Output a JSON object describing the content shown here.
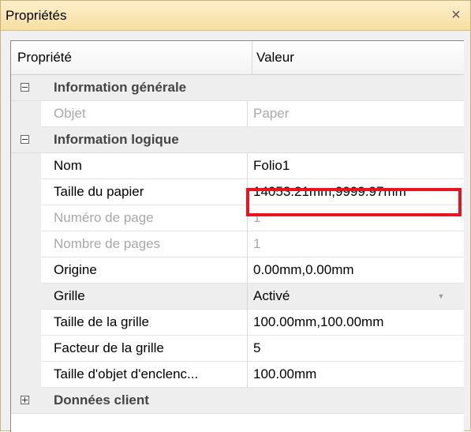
{
  "panel": {
    "title": "Propriétés",
    "close_glyph": "×"
  },
  "grid": {
    "header": {
      "property": "Propriété",
      "value": "Valeur"
    },
    "categories": [
      {
        "label": "Information générale",
        "expanded": true,
        "rows": [
          {
            "name": "Objet",
            "value": "Paper",
            "disabled": true
          }
        ]
      },
      {
        "label": "Information logique",
        "expanded": true,
        "rows": [
          {
            "name": "Nom",
            "value": "Folio1",
            "disabled": false
          },
          {
            "name": "Taille du papier",
            "value": "14053.21mm,9999.97mm",
            "disabled": false,
            "highlighted": true
          },
          {
            "name": "Numéro de page",
            "value": "1",
            "disabled": true
          },
          {
            "name": "Nombre de pages",
            "value": "1",
            "disabled": true
          },
          {
            "name": "Origine",
            "value": "0.00mm,0.00mm",
            "disabled": false
          },
          {
            "name": "Grille",
            "value": "Activé",
            "disabled": false,
            "dropdown": true
          },
          {
            "name": "Taille de la grille",
            "value": "100.00mm,100.00mm",
            "disabled": false
          },
          {
            "name": "Facteur de la grille",
            "value": "5",
            "disabled": false
          },
          {
            "name": "Taille d'objet d'enclenc...",
            "value": "100.00mm",
            "disabled": false
          }
        ]
      },
      {
        "label": "Données client",
        "expanded": false,
        "rows": []
      }
    ]
  },
  "colors": {
    "titlebar_top": "#fdefcb",
    "titlebar_bottom": "#f7dfa2",
    "highlight_border": "#e8141e",
    "disabled_text": "#a8a8a8"
  }
}
